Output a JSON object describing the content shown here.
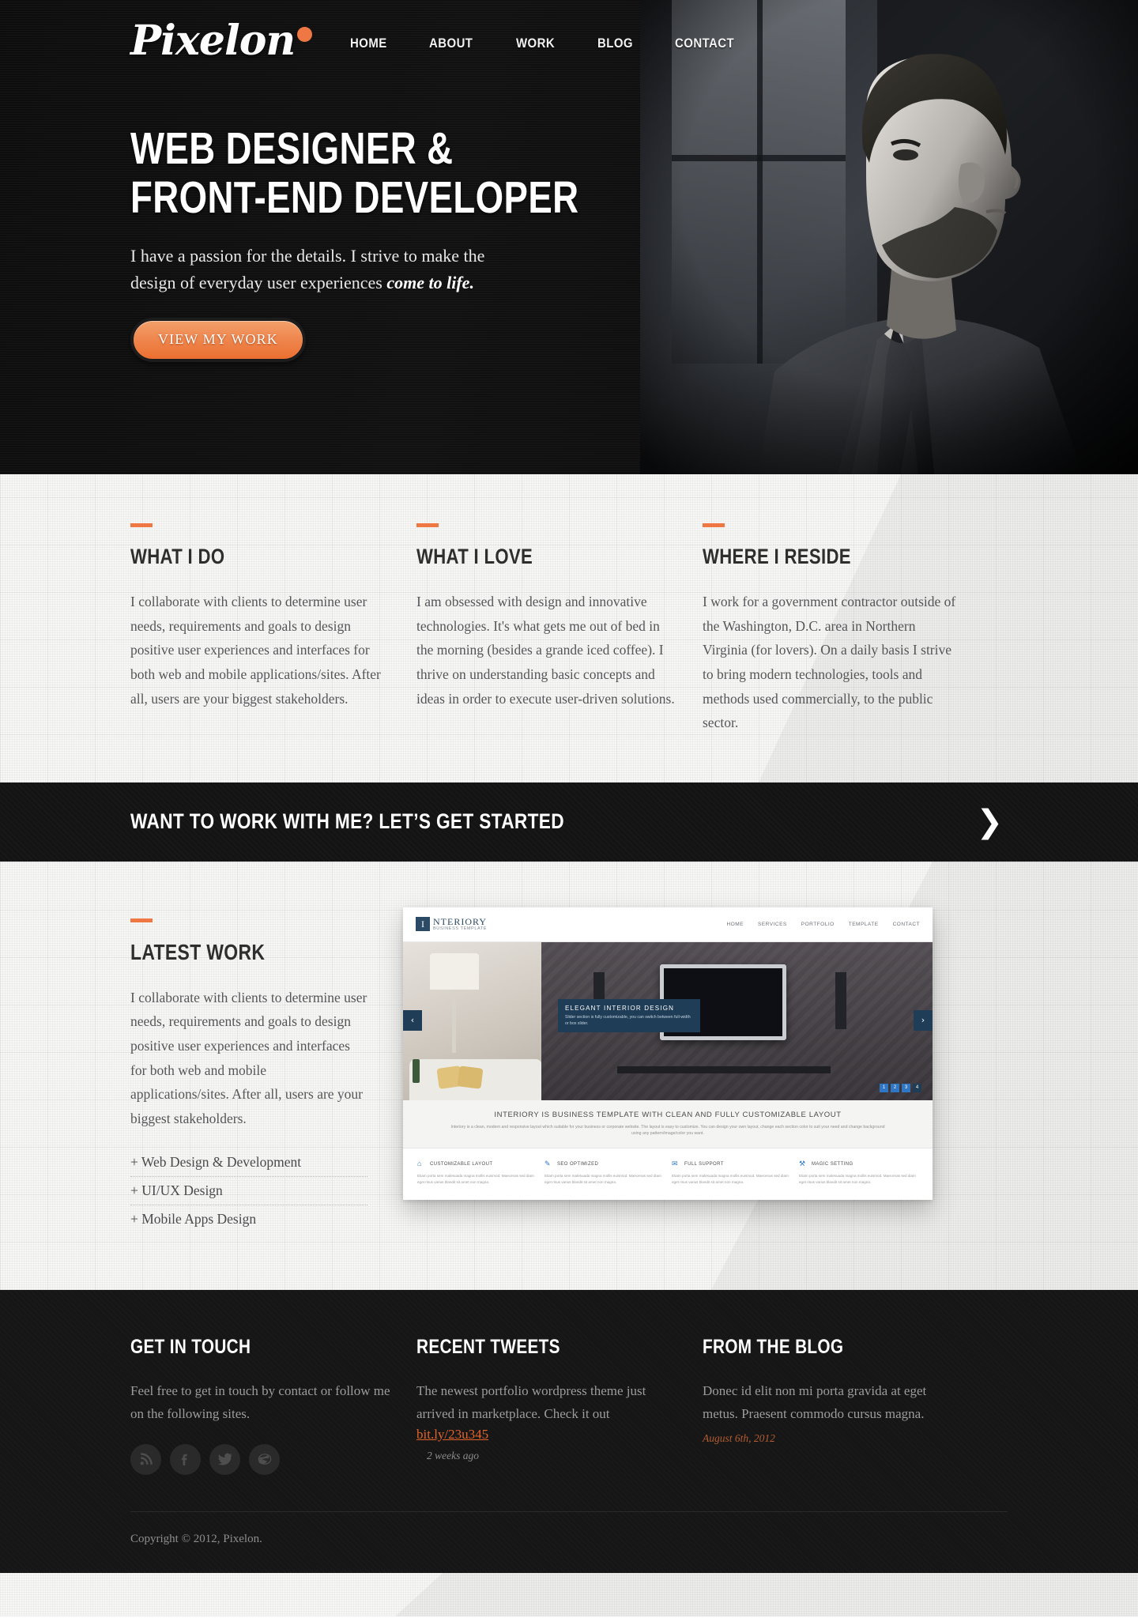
{
  "brand": {
    "name": "Pixelon",
    "accent": "#ef7743"
  },
  "nav": {
    "items": [
      {
        "label": "HOME"
      },
      {
        "label": "ABOUT"
      },
      {
        "label": "WORK"
      },
      {
        "label": "BLOG"
      },
      {
        "label": "CONTACT"
      }
    ]
  },
  "hero": {
    "title_line1": "WEB DESIGNER &",
    "title_line2": "FRONT-END DEVELOPER",
    "sub_plain": "I have a passion for the details. I strive to make the design of everyday user experiences ",
    "sub_emph": "come to life.",
    "cta_label": "VIEW MY WORK"
  },
  "about": {
    "columns": [
      {
        "heading": "WHAT I DO",
        "body": "I collaborate with clients to determine user needs, requirements and goals to design positive user experiences and interfaces for both web and mobile applications/sites. After all, users are your biggest stakeholders."
      },
      {
        "heading": "WHAT I LOVE",
        "body": "I am obsessed with design and innovative technologies. It's what gets me out of bed in the morning (besides a grande iced coffee). I thrive on understanding basic concepts and ideas in order to execute user-driven solutions."
      },
      {
        "heading": "WHERE I RESIDE",
        "body": "I work for a government contractor outside of the Washington, D.C. area in Northern Virginia (for lovers). On a daily basis I strive to bring modern technologies, tools and methods used commercially, to the public sector."
      }
    ]
  },
  "cta_banner": {
    "text": "WANT TO WORK WITH ME? LET’S GET STARTED",
    "arrow": "❯"
  },
  "work": {
    "heading": "LATEST WORK",
    "body": "I collaborate with clients to determine user needs, requirements and goals to design positive user experiences and interfaces for both web and mobile applications/sites. After all, users are your biggest stakeholders.",
    "services": [
      "+ Web Design & Development",
      "+ UI/UX Design",
      "+ Mobile Apps Design"
    ],
    "screenshot": {
      "logo_initial": "I",
      "logo_name": "NTERIORY",
      "logo_tagline": "BUSINESS TEMPLATE",
      "menu": [
        "HOME",
        "SERVICES",
        "PORTFOLIO",
        "TEMPLATE",
        "CONTACT"
      ],
      "slide_title": "ELEGANT INTERIOR DESIGN",
      "slide_desc": "Slider section is fully customizable, you can switch between full-width or box slider.",
      "slide_dots": [
        "1",
        "2",
        "3",
        "4"
      ],
      "arrow_left": "‹",
      "arrow_right": "›",
      "blurb_title": "INTERIORY IS BUSINESS TEMPLATE WITH  CLEAN AND FULLY CUSTOMIZABLE LAYOUT",
      "blurb_desc": "Interiory is a clean, modern and responsive layout which suitable for your business or corporate website. The layout is easy to customize. You can design your own layout, change each section color to suit your need and change background using any pattern/image/color you want.",
      "features": [
        {
          "icon": "⌂",
          "title": "CUSTOMIZABLE LAYOUT",
          "desc": "Etiam porta sem malesuada magna mollis euismod. Maecenas sed diam eget risus varius blandit sit amet non magna."
        },
        {
          "icon": "✎",
          "title": "SEO OPTIMIZED",
          "desc": "Etiam porta sem malesuada magna mollis euismod. Maecenas sed diam eget risus varius blandit sit amet non magna."
        },
        {
          "icon": "✉",
          "title": "FULL SUPPORT",
          "desc": "Etiam porta sem malesuada magna mollis euismod. Maecenas sed diam eget risus varius blandit sit amet non magna."
        },
        {
          "icon": "⚒",
          "title": "MAGIC SETTING",
          "desc": "Etiam porta sem malesuada magna mollis euismod. Maecenas sed diam eget risus varius blandit sit amet non magna."
        }
      ]
    }
  },
  "footer": {
    "touch": {
      "heading": "GET IN TOUCH",
      "body": "Feel free to get in touch by contact or follow me on the following sites.",
      "socials": [
        {
          "name": "rss-icon"
        },
        {
          "name": "facebook-icon"
        },
        {
          "name": "twitter-icon"
        },
        {
          "name": "dribbble-icon"
        }
      ]
    },
    "tweets": {
      "heading": "RECENT TWEETS",
      "body": "The newest portfolio wordpress theme just arrived in marketplace. Check it out",
      "link": "bit.ly/23u345",
      "time": "2 weeks ago"
    },
    "blog": {
      "heading": "FROM THE BLOG",
      "body": "Donec id elit non mi porta gravida at eget metus. Praesent commodo cursus magna.",
      "date": "August 6th, 2012"
    },
    "copyright": "Copyright © 2012, Pixelon."
  }
}
